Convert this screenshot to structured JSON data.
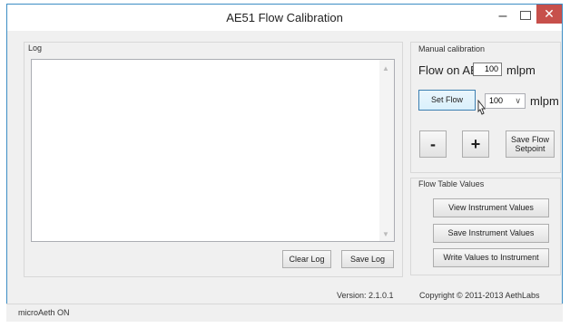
{
  "window": {
    "title": "AE51 Flow Calibration"
  },
  "log": {
    "label": "Log",
    "clear_label": "Clear Log",
    "save_label": "Save Log"
  },
  "manual": {
    "label": "Manual calibration",
    "flow_label": "Flow on AE51:",
    "flow_value": "100",
    "unit": "mlpm",
    "set_flow_label": "Set Flow",
    "combo_value": "100",
    "minus_label": "-",
    "plus_label": "+",
    "save_setpoint_line1": "Save Flow",
    "save_setpoint_line2": "Setpoint"
  },
  "flow_table": {
    "label": "Flow Table Values",
    "view_label": "View Instrument Values",
    "save_label": "Save Instrument Values",
    "write_label": "Write Values to Instrument"
  },
  "footer": {
    "version": "Version: 2.1.0.1",
    "copyright": "Copyright © 2011-2013 AethLabs"
  },
  "status": {
    "text": "microAeth ON"
  }
}
